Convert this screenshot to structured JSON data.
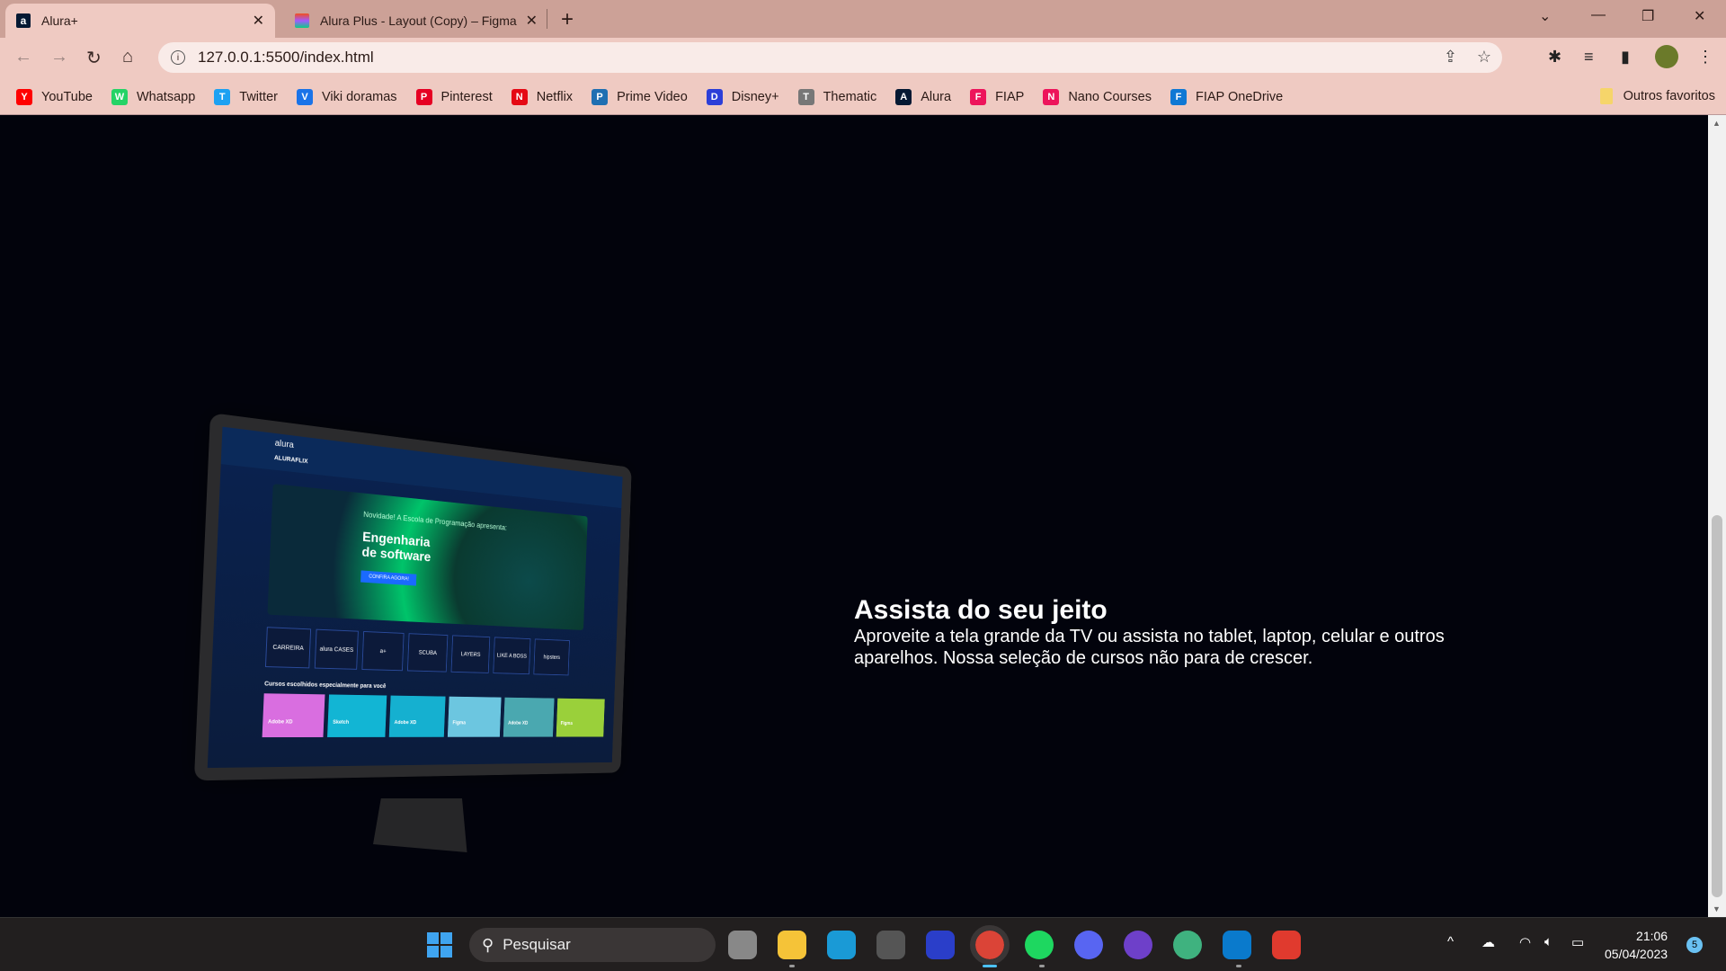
{
  "browser": {
    "tabs": [
      {
        "title": "Alura+",
        "active": true,
        "icon": "alura-icon"
      },
      {
        "title": "Alura Plus - Layout (Copy) – Figma",
        "active": false,
        "icon": "figma-icon"
      }
    ],
    "url": "127.0.0.1:5500/index.html",
    "bookmarks": [
      {
        "label": "YouTube",
        "icon": "youtube-icon",
        "color": "#ff0000"
      },
      {
        "label": "Whatsapp",
        "icon": "whatsapp-icon",
        "color": "#25d366"
      },
      {
        "label": "Twitter",
        "icon": "twitter-icon",
        "color": "#1da1f2"
      },
      {
        "label": "Viki doramas",
        "icon": "viki-icon",
        "color": "#1a73e8"
      },
      {
        "label": "Pinterest",
        "icon": "pinterest-icon",
        "color": "#e60023"
      },
      {
        "label": "Netflix",
        "icon": "netflix-icon",
        "color": "#e50914"
      },
      {
        "label": "Prime Video",
        "icon": "prime-video-icon",
        "color": "#1f6fb2"
      },
      {
        "label": "Disney+",
        "icon": "disney-icon",
        "color": "#2c3ed8"
      },
      {
        "label": "Thematic",
        "icon": "thematic-icon",
        "color": "#777777"
      },
      {
        "label": "Alura",
        "icon": "alura-icon",
        "color": "#051933"
      },
      {
        "label": "FIAP",
        "icon": "fiap-icon",
        "color": "#ed145b"
      },
      {
        "label": "Nano Courses",
        "icon": "fiap-icon",
        "color": "#ed145b"
      },
      {
        "label": "FIAP OneDrive",
        "icon": "onedrive-icon",
        "color": "#0f78d4"
      }
    ],
    "other_bookmarks": "Outros favoritos"
  },
  "hero": {
    "title": "Assista do seu jeito",
    "description": "Aproveite a tela grande da TV ou assista no tablet, laptop, celular e outros aparelhos. Nossa seleção de cursos não para de crescer."
  },
  "mockup": {
    "logo": "alura",
    "brand": "ALURAFLIX",
    "banner_kicker": "Novidade! A Escola de Programação apresenta:",
    "banner_title": "Engenharia de software",
    "banner_button": "CONFIRA AGORA!",
    "tiles": [
      "CARREIRA",
      "alura CASES",
      "a+",
      "SCUBA",
      "LAYERS",
      "LIKE A BOSS",
      "hipsters"
    ],
    "section_title": "Cursos escolhidos especialmente para você",
    "cards": [
      {
        "label": "Adobe XD",
        "color": "#d96ee0"
      },
      {
        "label": "Sketch",
        "color": "#12b5d4"
      },
      {
        "label": "Adobe XD",
        "color": "#15b0d0"
      },
      {
        "label": "Figma",
        "color": "#6cc6e0"
      },
      {
        "label": "Adobe XD",
        "color": "#4aa8b0"
      },
      {
        "label": "Figma",
        "color": "#9ad03a"
      }
    ]
  },
  "taskbar": {
    "search_placeholder": "Pesquisar",
    "apps": [
      "task-view-icon",
      "file-explorer-icon",
      "edge-icon",
      "settings-icon",
      "cortana-icon",
      "chrome-icon",
      "spotify-icon",
      "discord-icon",
      "github-desktop-icon",
      "atom-icon",
      "vscode-icon",
      "todoist-icon"
    ],
    "time": "21:06",
    "date": "05/04/2023",
    "notifications": "5"
  }
}
